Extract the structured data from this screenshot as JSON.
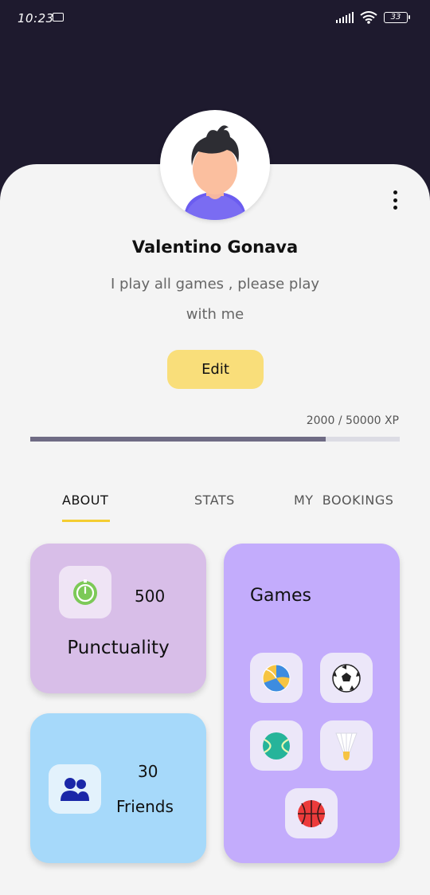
{
  "status_bar": {
    "time": "10:23",
    "battery": "33"
  },
  "profile": {
    "name": "Valentino Gonava",
    "bio_line1": "I play all games , please play",
    "bio_line2": "with me",
    "edit_label": "Edit",
    "avatar_icon": "person-avatar-icon"
  },
  "xp": {
    "text": "2000 / 50000 XP",
    "current": 2000,
    "max": 50000,
    "bar_fill_fraction": 0.8
  },
  "tabs": [
    {
      "label": "ABOUT",
      "active": true
    },
    {
      "label": "STATS",
      "active": false
    },
    {
      "label": "MY  BOOKINGS",
      "active": false
    }
  ],
  "about": {
    "punctuality": {
      "value": "500",
      "label": "Punctuality",
      "icon": "stopwatch-icon"
    },
    "friends": {
      "value": "30",
      "label": "Friends",
      "icon": "people-icon"
    },
    "games": {
      "title": "Games",
      "items": [
        {
          "icon": "volleyball-icon"
        },
        {
          "icon": "soccer-ball-icon"
        },
        {
          "icon": "tennis-ball-icon"
        },
        {
          "icon": "shuttlecock-icon"
        },
        {
          "icon": "basketball-icon"
        }
      ]
    }
  },
  "colors": {
    "header_bg": "#1e1a2e",
    "edit_button": "#f9de7a",
    "tab_indicator": "#f4cd32",
    "punctuality_tile": "#d8bee8",
    "friends_tile": "#a6d9fa",
    "games_tile": "#c3acfc",
    "xp_fill": "#6f6b84"
  }
}
